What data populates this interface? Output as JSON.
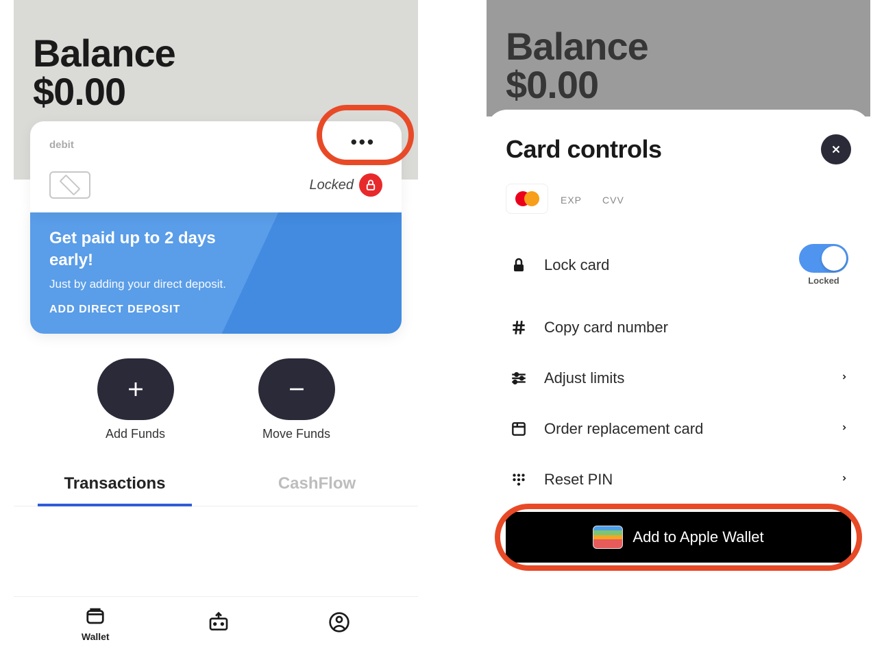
{
  "left": {
    "balance_title": "Balance",
    "balance_amount": "$0.00",
    "card": {
      "type": "debit",
      "locked_text": "Locked"
    },
    "promo": {
      "title": "Get paid up to 2 days early!",
      "subtitle": "Just by adding your direct deposit.",
      "cta": "ADD DIRECT DEPOSIT"
    },
    "actions": {
      "add": "Add Funds",
      "move": "Move Funds"
    },
    "tabs": {
      "transactions": "Transactions",
      "cashflow": "CashFlow"
    },
    "nav": {
      "wallet": "Wallet"
    }
  },
  "right": {
    "balance_title": "Balance",
    "balance_amount": "$0.00",
    "sheet_title": "Card controls",
    "card_meta": {
      "exp_label": "EXP",
      "cvv_label": "CVV"
    },
    "controls": {
      "lock": "Lock card",
      "lock_status": "Locked",
      "copy": "Copy card number",
      "limits": "Adjust limits",
      "order": "Order replacement card",
      "reset": "Reset PIN"
    },
    "apple_wallet": "Add to Apple Wallet"
  }
}
